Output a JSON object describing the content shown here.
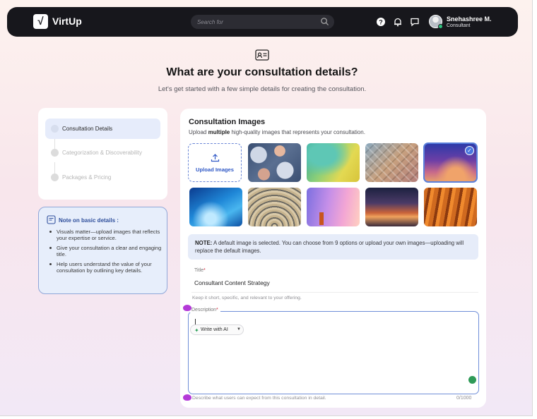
{
  "header": {
    "logo_text": "VirtUp",
    "search_placeholder": "Search for",
    "user_name": "Snehashree M.",
    "user_role": "Consultant"
  },
  "hero": {
    "title": "What are your consultation details?",
    "subtitle": "Let's get started with a few simple details for creating the consultation."
  },
  "steps": [
    {
      "label": "Consultation Details",
      "active": true
    },
    {
      "label": "Categorization & Discoverability",
      "active": false
    },
    {
      "label": "Packages & Pricing",
      "active": false
    }
  ],
  "note": {
    "title": "Note on basic details :",
    "items": [
      "Visuals matter—upload images that reflects your expertise or service.",
      "Give your consultation a clear and engaging title.",
      "Help users understand the value of your consultation by outlining key details."
    ]
  },
  "images": {
    "title": "Consultation Images",
    "subtitle_pre": "Upload ",
    "subtitle_bold": "multiple",
    "subtitle_post": " high-quality images that represents your consultation.",
    "upload_label": "Upload Images",
    "selected_index": 3
  },
  "info": {
    "bold": "NOTE:",
    "text": " A default image is selected. You can choose from 9 options or upload your own images—uploading will replace the default images."
  },
  "title_field": {
    "label": "Title",
    "required_mark": "*",
    "value": "Consultant Content Strategy",
    "hint": "Keep it short, specific, and relevant to your offering."
  },
  "description_field": {
    "label": "Description",
    "required_mark": "*",
    "ai_button": "Write with AI",
    "hint": "Describe what users can expect from this consultation in detail.",
    "counter": "0/1000"
  },
  "colors": {
    "accent": "#2f58c6",
    "header_bg": "#17171c",
    "required": "#d3273a"
  }
}
